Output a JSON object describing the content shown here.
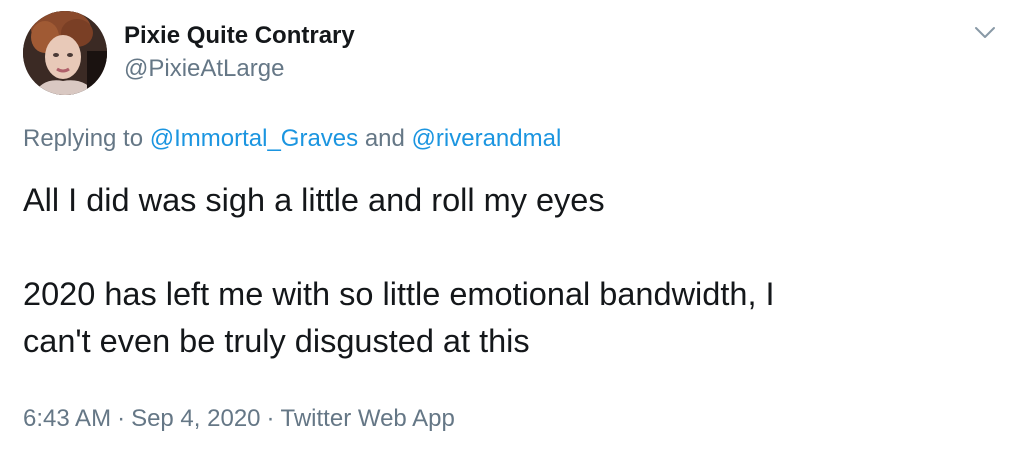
{
  "author": {
    "display_name": "Pixie Quite Contrary",
    "handle": "@PixieAtLarge"
  },
  "icons": {
    "menu": "chevron-down-icon",
    "avatar": "profile-photo"
  },
  "reply": {
    "prefix": "Replying to ",
    "mention_1": "@Immortal_Graves",
    "conjunction": " and ",
    "mention_2": "@riverandmal"
  },
  "tweet": {
    "line_1": "All I did was sigh a little and roll my eyes",
    "line_2": "2020 has left me with so little emotional bandwidth, I",
    "line_3": "can't even be truly disgusted at this"
  },
  "meta": {
    "time": "6:43 AM",
    "separator": "·",
    "date": "Sep 4, 2020",
    "source": "Twitter Web App"
  },
  "colors": {
    "text": "#14171a",
    "secondary": "#657786",
    "link": "#1b95e0"
  }
}
